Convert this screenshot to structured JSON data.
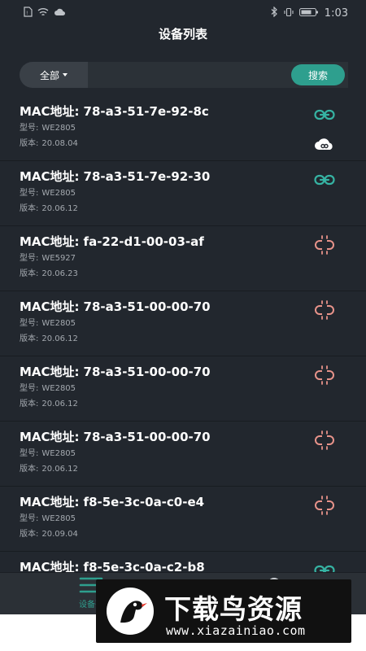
{
  "statusbar": {
    "time": "1:03"
  },
  "header": {
    "title": "设备列表"
  },
  "search": {
    "filter_label": "全部",
    "placeholder": "",
    "button_label": "搜索"
  },
  "labels": {
    "mac": "MAC地址:",
    "model": "型号:",
    "version": "版本:"
  },
  "colors": {
    "accent": "#2e9f8e",
    "link_connected": "#36b3a3",
    "link_broken": "#e8938a",
    "background": "#22272e"
  },
  "devices": [
    {
      "mac": "78-a3-51-7e-92-8c",
      "model": "WE2805",
      "version": "20.08.04",
      "status_icon": "link-icon",
      "cloud": true
    },
    {
      "mac": "78-a3-51-7e-92-30",
      "model": "WE2805",
      "version": "20.06.12",
      "status_icon": "link-icon",
      "cloud": false
    },
    {
      "mac": "fa-22-d1-00-03-af",
      "model": "WE5927",
      "version": "20.06.23",
      "status_icon": "broken-link-icon",
      "cloud": false
    },
    {
      "mac": "78-a3-51-00-00-70",
      "model": "WE2805",
      "version": "20.06.12",
      "status_icon": "broken-link-icon",
      "cloud": false
    },
    {
      "mac": "78-a3-51-00-00-70",
      "model": "WE2805",
      "version": "20.06.12",
      "status_icon": "broken-link-icon",
      "cloud": false
    },
    {
      "mac": "78-a3-51-00-00-70",
      "model": "WE2805",
      "version": "20.06.12",
      "status_icon": "broken-link-icon",
      "cloud": false
    },
    {
      "mac": "f8-5e-3c-0a-c0-e4",
      "model": "WE2805",
      "version": "20.09.04",
      "status_icon": "broken-link-icon",
      "cloud": false
    },
    {
      "mac": "f8-5e-3c-0a-c2-b8",
      "status_icon": "link-icon",
      "cloud": false
    }
  ],
  "tabbar": {
    "devices_label": "设备列"
  },
  "watermark": {
    "title": "下载鸟资源",
    "url": "www.xiazainiao.com"
  }
}
